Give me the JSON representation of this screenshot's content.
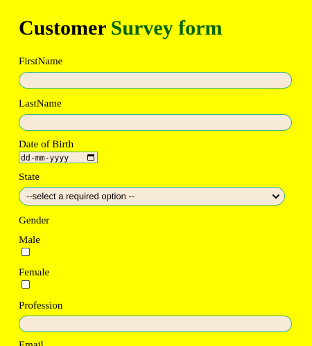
{
  "header": {
    "title_part1": "Customer",
    "title_part2": "Survey form"
  },
  "fields": {
    "first_name": {
      "label": "FirstName",
      "value": ""
    },
    "last_name": {
      "label": "LastName",
      "value": ""
    },
    "dob": {
      "label": "Date of Birth",
      "placeholder": "dd-mm-yyyy"
    },
    "state": {
      "label": "State",
      "selected": "--select a required option --"
    },
    "gender": {
      "label": "Gender",
      "options": [
        {
          "label": "Male",
          "checked": false
        },
        {
          "label": "Female",
          "checked": false
        }
      ]
    },
    "profession": {
      "label": "Profession",
      "value": ""
    },
    "email": {
      "label": "Email"
    }
  },
  "colors": {
    "background": "#ffff00",
    "title_accent": "#006400",
    "input_fill": "#f8ead8",
    "input_border": "#3cb371"
  },
  "icons": [
    "calendar-icon",
    "chevron-down-icon"
  ]
}
